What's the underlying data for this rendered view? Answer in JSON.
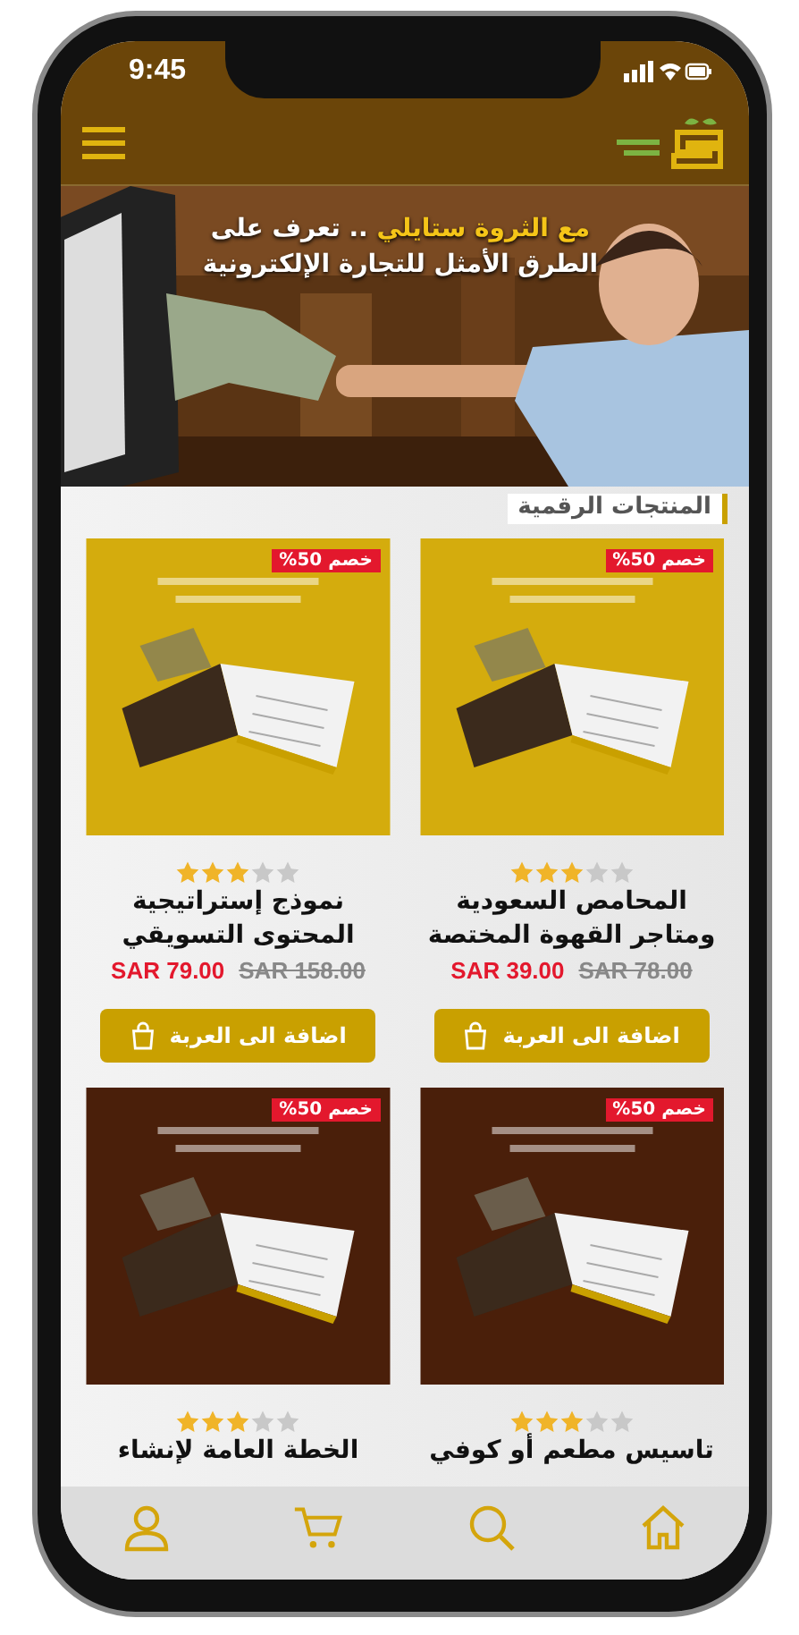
{
  "status_bar": {
    "time": "9:45"
  },
  "banner": {
    "highlight": "مع الثروة ستايلي",
    "line_1": ".. تعرف على",
    "line_2": "الطرق الأمثل للتجارة الإلكترونية"
  },
  "section_title": "المنتجات الرقمية",
  "products": [
    {
      "kind": "gold",
      "badge": "خصم 50%",
      "stars": 3,
      "title": "المحامص السعودية ومتاجر القهوة المختصة",
      "price": "SAR 39.00",
      "old_price": "SAR 78.00",
      "button": "اضافة الى العربة"
    },
    {
      "kind": "gold",
      "badge": "خصم 50%",
      "stars": 3,
      "title": "نموذج إستراتيجية المحتوى التسويقي",
      "price": "SAR 79.00",
      "old_price": "SAR 158.00",
      "button": "اضافة الى العربة"
    },
    {
      "kind": "brown",
      "badge": "خصم 50%",
      "stars": 3,
      "title": "تاسيس مطعم أو كوفي"
    },
    {
      "kind": "brown",
      "badge": "خصم 50%",
      "stars": 3,
      "title": "الخطة العامة لإنشاء"
    }
  ]
}
